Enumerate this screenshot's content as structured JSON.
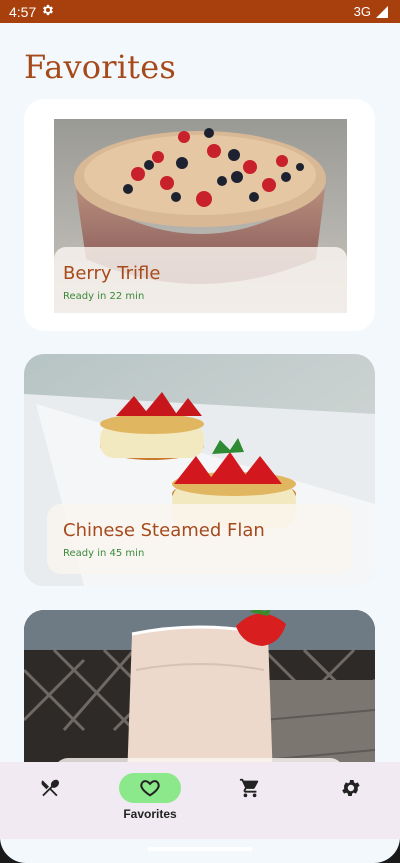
{
  "status_bar": {
    "time": "4:57",
    "network": "3G",
    "settings_icon": "gear-icon",
    "signal_icon": "signal-icon"
  },
  "page": {
    "title": "Favorites"
  },
  "recipes": [
    {
      "title": "Berry Trifle",
      "time": "Ready in 22 min",
      "image": "berry-trifle-photo"
    },
    {
      "title": "Chinese Steamed Flan",
      "time": "Ready in 45 min",
      "image": "steamed-flan-photo"
    },
    {
      "title": "",
      "time": "",
      "image": "smoothie-photo"
    }
  ],
  "bottom_nav": {
    "items": [
      {
        "label": "",
        "icon": "utensils-icon",
        "active": false
      },
      {
        "label": "Favorites",
        "icon": "heart-icon",
        "active": true
      },
      {
        "label": "",
        "icon": "cart-icon",
        "active": false
      },
      {
        "label": "",
        "icon": "gear-icon",
        "active": false
      }
    ]
  },
  "colors": {
    "status_bar": "#a8400e",
    "title": "#a64a1c",
    "time_text": "#3a8a3a",
    "nav_active": "#8be88b",
    "nav_bg": "#f1eaf2"
  }
}
